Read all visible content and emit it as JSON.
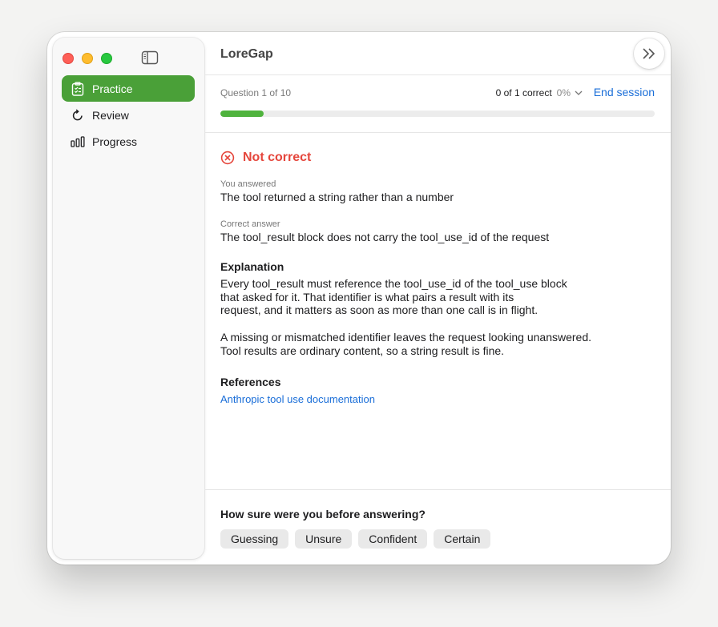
{
  "app": {
    "title": "LoreGap"
  },
  "sidebar": {
    "items": [
      {
        "label": "Practice",
        "icon": "clipboard-icon",
        "active": true
      },
      {
        "label": "Review",
        "icon": "refresh-icon"
      },
      {
        "label": "Progress",
        "icon": "bar-chart-icon"
      }
    ]
  },
  "session": {
    "counter": "Question 1 of 10",
    "score": "0 of 1 correct",
    "percent": "0%",
    "end_label": "End session",
    "progress_fraction": 0.1
  },
  "result": {
    "verdict": "Not correct",
    "you_answered_label": "You answered",
    "you_answered": "The tool returned a string rather than a number",
    "correct_label": "Correct answer",
    "correct_answer": "The tool_result block does not carry the tool_use_id of the request",
    "explanation_heading": "Explanation",
    "explanation_p1": [
      "Every tool_result must reference the tool_use_id of the tool_use block",
      "that asked for it. That identifier is what pairs a result with its",
      "request, and it matters as soon as more than one call is in flight."
    ],
    "explanation_p2": [
      "A missing or mismatched identifier leaves the request looking unanswered.",
      "Tool results are ordinary content, so a string result is fine."
    ],
    "references_heading": "References",
    "reference_link": "Anthropic tool use documentation"
  },
  "confidence": {
    "question": "How sure were you before answering?",
    "options": [
      "Guessing",
      "Unsure",
      "Confident",
      "Certain"
    ]
  },
  "colors": {
    "accent_green": "#4aa038",
    "error_red": "#e5463c",
    "link_blue": "#1a6ed8"
  }
}
